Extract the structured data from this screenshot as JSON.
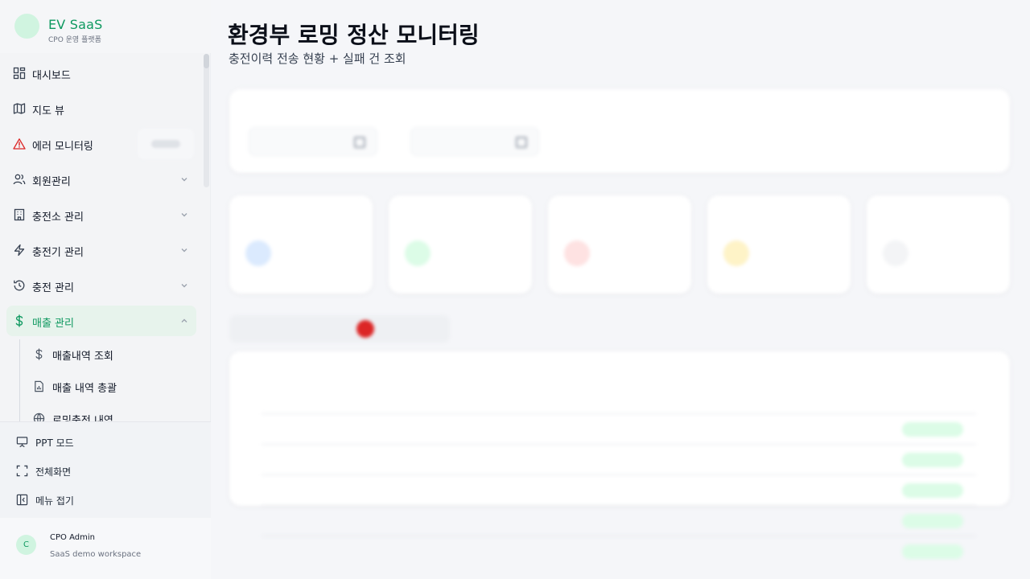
{
  "brand": {
    "name": "EV SaaS",
    "subtitle": "CPO 운영 플랫폼"
  },
  "nav": {
    "items": [
      {
        "label": "대시보드",
        "icon": "dashboard-icon"
      },
      {
        "label": "지도 뷰",
        "icon": "map-icon"
      },
      {
        "label": "에러 모니터링",
        "icon": "warning-icon"
      },
      {
        "label": "회원관리",
        "icon": "users-icon"
      },
      {
        "label": "충전소 관리",
        "icon": "building-icon"
      },
      {
        "label": "충전기 관리",
        "icon": "bolt-icon"
      },
      {
        "label": "충전 관리",
        "icon": "history-icon"
      },
      {
        "label": "매출 관리",
        "icon": "dollar-icon",
        "active": true
      }
    ],
    "sub_items": [
      {
        "label": "매출내역 조회",
        "icon": "dollar-icon"
      },
      {
        "label": "매출 내역 총괄",
        "icon": "report-icon"
      },
      {
        "label": "로밍충전 내역",
        "icon": "globe-icon"
      }
    ]
  },
  "tools": {
    "ppt_label": "PPT 모드",
    "fullscreen_label": "전체화면",
    "collapse_label": "메뉴 접기"
  },
  "user": {
    "initial": "C",
    "name": "CPO Admin",
    "workspace": "SaaS demo workspace"
  },
  "page": {
    "title": "환경부 로밍 정산 모니터링",
    "subtitle": "충전이력 전송 현황 + 실패 건 조회"
  },
  "colors": {
    "accent": "#0f9960",
    "danger": "#dc2626",
    "warning": "#eab308",
    "info": "#3b82f6"
  }
}
